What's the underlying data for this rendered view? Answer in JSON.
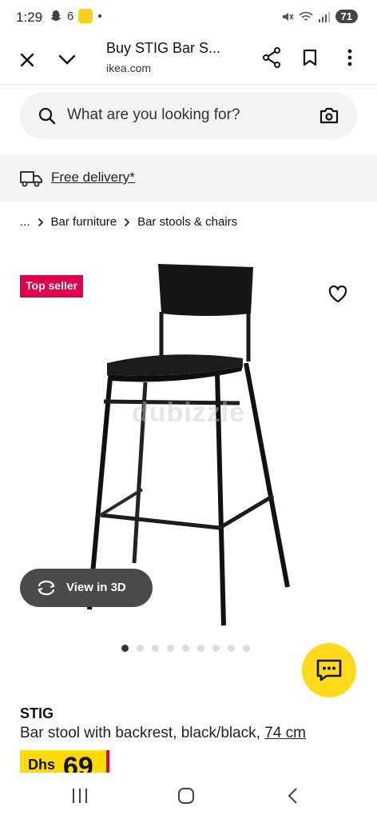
{
  "status_bar": {
    "time": "1:29",
    "notification_count": "6",
    "battery": "71"
  },
  "browser": {
    "title": "Buy STIG Bar S...",
    "url": "ikea.com"
  },
  "search": {
    "placeholder": "What are you looking for?"
  },
  "delivery": {
    "label": "Free delivery*"
  },
  "breadcrumb": {
    "ellipsis": "...",
    "items": [
      "Bar furniture",
      "Bar stools & chairs"
    ]
  },
  "product": {
    "badge": "Top seller",
    "watermark": "dubizzle",
    "view3d_label": "View in 3D",
    "carousel": {
      "count": 9,
      "active": 0
    },
    "name": "STIG",
    "description": "Bar stool with backrest, black/black, ",
    "size": "74 cm",
    "price_currency": "Dhs",
    "price_value": "69"
  },
  "colors": {
    "badge_red": "#e0004d",
    "ikea_yellow": "#ffda1a",
    "view3d_bg": "#4a4a4a"
  },
  "icons": [
    "close-icon",
    "chevron-down-icon",
    "share-icon",
    "bookmark-icon",
    "more-icon",
    "search-icon",
    "camera-icon",
    "truck-icon",
    "heart-icon",
    "rotate-3d-icon",
    "chat-icon",
    "recents-icon",
    "home-icon",
    "back-icon"
  ]
}
